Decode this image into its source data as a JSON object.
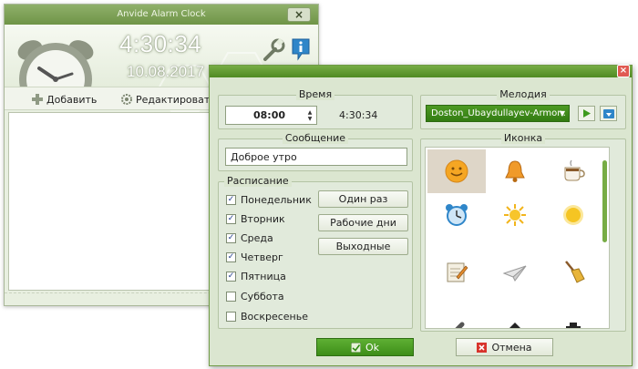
{
  "main_window": {
    "title": "Anvide Alarm Clock",
    "close_glyph": "×",
    "time": "4:30:34",
    "date": "10.08.2017",
    "toolbar": {
      "add_label": "Добавить",
      "edit_label": "Редактировать"
    }
  },
  "dialog": {
    "close_glyph": "×",
    "time_group": {
      "title": "Время",
      "alarm_time": "08:00",
      "current_time": "4:30:34"
    },
    "melody_group": {
      "title": "Мелодия",
      "selected": "Doston_Ubaydullayev-Armon."
    },
    "message_group": {
      "title": "Сообщение",
      "value": "Доброе утро"
    },
    "schedule_group": {
      "title": "Расписание",
      "days": [
        {
          "label": "Понедельник",
          "checked": true
        },
        {
          "label": "Вторник",
          "checked": true
        },
        {
          "label": "Среда",
          "checked": true
        },
        {
          "label": "Четверг",
          "checked": true
        },
        {
          "label": "Пятница",
          "checked": true
        },
        {
          "label": "Суббота",
          "checked": false
        },
        {
          "label": "Воскресенье",
          "checked": false
        }
      ],
      "buttons": {
        "once": "Один раз",
        "workdays": "Рабочие дни",
        "weekends": "Выходные"
      }
    },
    "icon_group": {
      "title": "Иконка",
      "icons": [
        "smiley-icon",
        "bell-icon",
        "coffee-cup-icon",
        "alarm-clock-icon",
        "sun-rays-icon",
        "sun-icon",
        "notepad-pencil-icon",
        "paper-plane-icon",
        "broom-icon"
      ],
      "selected_index": 0
    },
    "ok_label": "Ok",
    "cancel_label": "Отмена"
  },
  "colors": {
    "accent_green": "#4f8a22",
    "window_bg": "#e8efe0",
    "dialog_bg": "#dbe6d0",
    "close_red": "#e05a52"
  }
}
